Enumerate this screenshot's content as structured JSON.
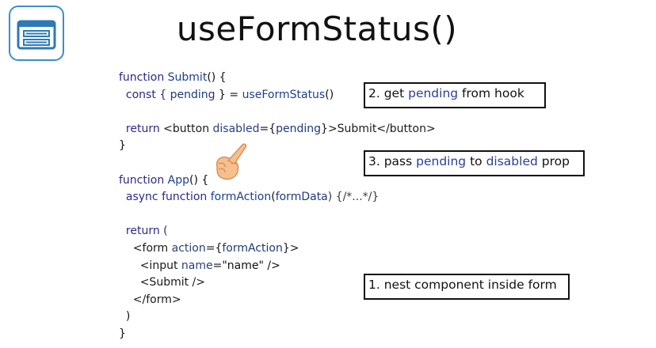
{
  "title": "useFormStatus()",
  "icons": {
    "app_icon": "browser-form-icon",
    "pointer": "pointing-hand-icon"
  },
  "code_lines": [
    [
      {
        "t": "function ",
        "c": "kw"
      },
      {
        "t": "Submit",
        "c": "fn"
      },
      {
        "t": "() {",
        "c": "str"
      }
    ],
    [
      {
        "t": "  const { ",
        "c": "kw"
      },
      {
        "t": "pending",
        "c": "var"
      },
      {
        "t": " } = ",
        "c": "str"
      },
      {
        "t": "useFormStatus",
        "c": "fn"
      },
      {
        "t": "()",
        "c": "str"
      }
    ],
    [
      {
        "t": "",
        "c": "str"
      }
    ],
    [
      {
        "t": "  return ",
        "c": "kw"
      },
      {
        "t": "<button ",
        "c": "tag"
      },
      {
        "t": "disabled",
        "c": "attr"
      },
      {
        "t": "={",
        "c": "str"
      },
      {
        "t": "pending",
        "c": "var"
      },
      {
        "t": "}>Submit</button>",
        "c": "tag"
      }
    ],
    [
      {
        "t": "}",
        "c": "str"
      }
    ],
    [
      {
        "t": "",
        "c": "str"
      }
    ],
    [
      {
        "t": "function ",
        "c": "kw"
      },
      {
        "t": "App",
        "c": "fn"
      },
      {
        "t": "() {",
        "c": "str"
      }
    ],
    [
      {
        "t": "  async function ",
        "c": "kw"
      },
      {
        "t": "formAction",
        "c": "fn"
      },
      {
        "t": "(",
        "c": "str"
      },
      {
        "t": "formData",
        "c": "var"
      },
      {
        "t": ") {/*...*/}",
        "c": "cmt"
      }
    ],
    [
      {
        "t": "",
        "c": "str"
      }
    ],
    [
      {
        "t": "  return (",
        "c": "kw"
      }
    ],
    [
      {
        "t": "    <form ",
        "c": "tag"
      },
      {
        "t": "action",
        "c": "attr"
      },
      {
        "t": "={",
        "c": "str"
      },
      {
        "t": "formAction",
        "c": "var"
      },
      {
        "t": "}>",
        "c": "tag"
      }
    ],
    [
      {
        "t": "      <input ",
        "c": "tag"
      },
      {
        "t": "name",
        "c": "attr"
      },
      {
        "t": "=\"name\" />",
        "c": "str"
      }
    ],
    [
      {
        "t": "      <Submit />",
        "c": "tag"
      }
    ],
    [
      {
        "t": "    </form>",
        "c": "tag"
      }
    ],
    [
      {
        "t": "  )",
        "c": "str"
      }
    ],
    [
      {
        "t": "}",
        "c": "str"
      }
    ]
  ],
  "callouts": [
    {
      "parts": [
        {
          "t": "2. get ",
          "hl": false
        },
        {
          "t": "pending",
          "hl": true
        },
        {
          "t": " from hook",
          "hl": false
        }
      ]
    },
    {
      "parts": [
        {
          "t": "3. pass ",
          "hl": false
        },
        {
          "t": "pending",
          "hl": true
        },
        {
          "t": " to ",
          "hl": false
        },
        {
          "t": "disabled",
          "hl": true
        },
        {
          "t": " prop",
          "hl": false
        }
      ]
    },
    {
      "parts": [
        {
          "t": "1. nest component inside form",
          "hl": false
        }
      ]
    }
  ]
}
